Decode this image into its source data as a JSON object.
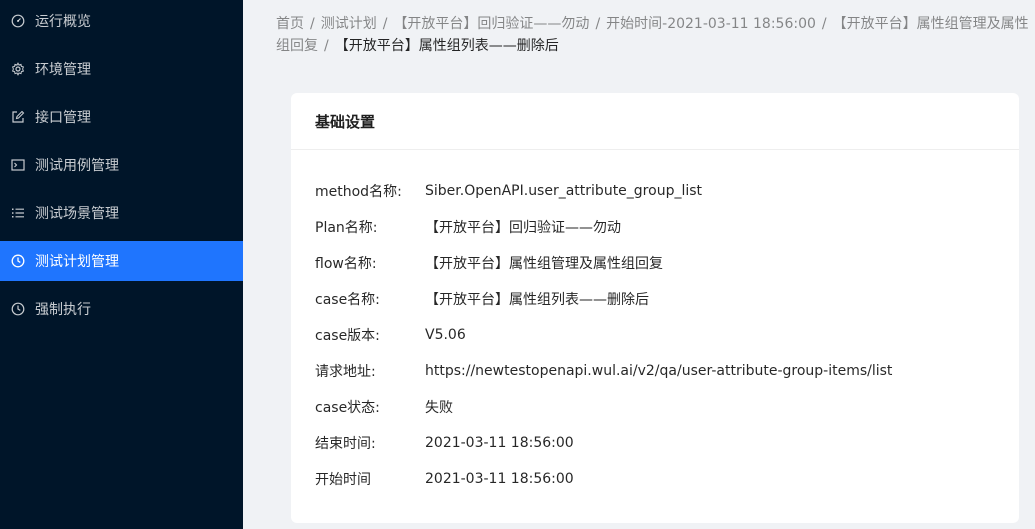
{
  "sidebar": {
    "items": [
      {
        "label": "运行概览",
        "icon": "dashboard-icon",
        "active": false
      },
      {
        "label": "环境管理",
        "icon": "gear-icon",
        "active": false
      },
      {
        "label": "接口管理",
        "icon": "edit-icon",
        "active": false
      },
      {
        "label": "测试用例管理",
        "icon": "terminal-icon",
        "active": false
      },
      {
        "label": "测试场景管理",
        "icon": "list-icon",
        "active": false
      },
      {
        "label": "测试计划管理",
        "icon": "clock-icon",
        "active": true
      },
      {
        "label": "强制执行",
        "icon": "clock-icon",
        "active": false
      }
    ],
    "active_color": "#1f75fe",
    "background": "#001529"
  },
  "breadcrumb": {
    "items": [
      "首页",
      "测试计划",
      "【开放平台】回归验证——勿动",
      "开始时间-2021-03-11 18:56:00",
      "【开放平台】属性组管理及属性组回复"
    ],
    "current": "【开放平台】属性组列表——删除后",
    "separator": "/"
  },
  "card": {
    "title": "基础设置",
    "rows": [
      {
        "label": "method名称:",
        "value": "Siber.OpenAPI.user_attribute_group_list"
      },
      {
        "label": "Plan名称:",
        "value": "【开放平台】回归验证——勿动"
      },
      {
        "label": "flow名称:",
        "value": "【开放平台】属性组管理及属性组回复"
      },
      {
        "label": "case名称:",
        "value": "【开放平台】属性组列表——删除后"
      },
      {
        "label": "case版本:",
        "value": "V5.06"
      },
      {
        "label": "请求地址:",
        "value": "https://newtestopenapi.wul.ai/v2/qa/user-attribute-group-items/list"
      },
      {
        "label": "case状态:",
        "value": "失败"
      },
      {
        "label": "结束时间:",
        "value": "2021-03-11 18:56:00"
      },
      {
        "label": "开始时间",
        "value": "2021-03-11 18:56:00"
      }
    ]
  }
}
